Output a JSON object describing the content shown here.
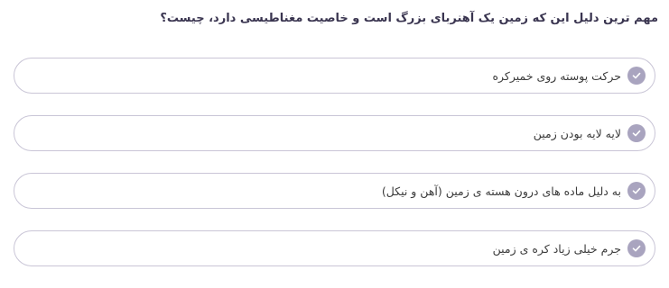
{
  "question": {
    "text": "مهم ترین دلیل این که زمین یک آهنربای بزرگ است و خاصیت مغناطیسی دارد، چیست؟"
  },
  "options": [
    {
      "label": "حرکت پوسته روی خمیرکره",
      "icon": "check-circle-icon"
    },
    {
      "label": "لایه لایه بودن زمین",
      "icon": "check-circle-icon"
    },
    {
      "label": "به دلیل ماده های درون هسته ی زمین (آهن و نیکل)",
      "icon": "check-circle-icon"
    },
    {
      "label": "جرم خیلی زیاد کره ی زمین",
      "icon": "check-circle-icon"
    }
  ],
  "colors": {
    "question_text": "#3a3550",
    "option_border": "#c9c5d6",
    "check_fill": "#a9a4bf",
    "option_text": "#3b3b3b"
  }
}
